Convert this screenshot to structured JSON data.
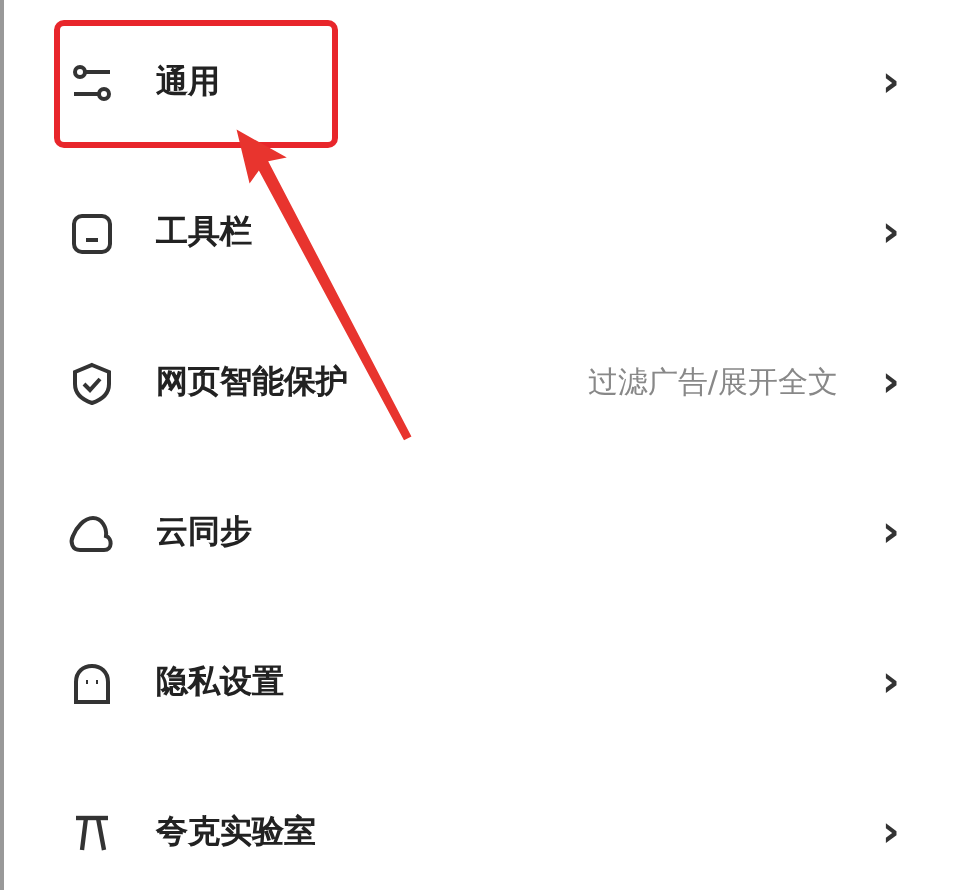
{
  "settings": {
    "items": [
      {
        "label": "通用",
        "chevron": "›",
        "highlighted": true
      },
      {
        "label": "工具栏",
        "chevron": "›",
        "highlighted": false
      },
      {
        "label": "网页智能保护",
        "value": "过滤广告/展开全文",
        "chevron": "›",
        "highlighted": false
      },
      {
        "label": "云同步",
        "chevron": "›",
        "highlighted": false
      },
      {
        "label": "隐私设置",
        "chevron": "›",
        "highlighted": false
      },
      {
        "label": "夸克实验室",
        "chevron": "›",
        "highlighted": false
      }
    ]
  }
}
